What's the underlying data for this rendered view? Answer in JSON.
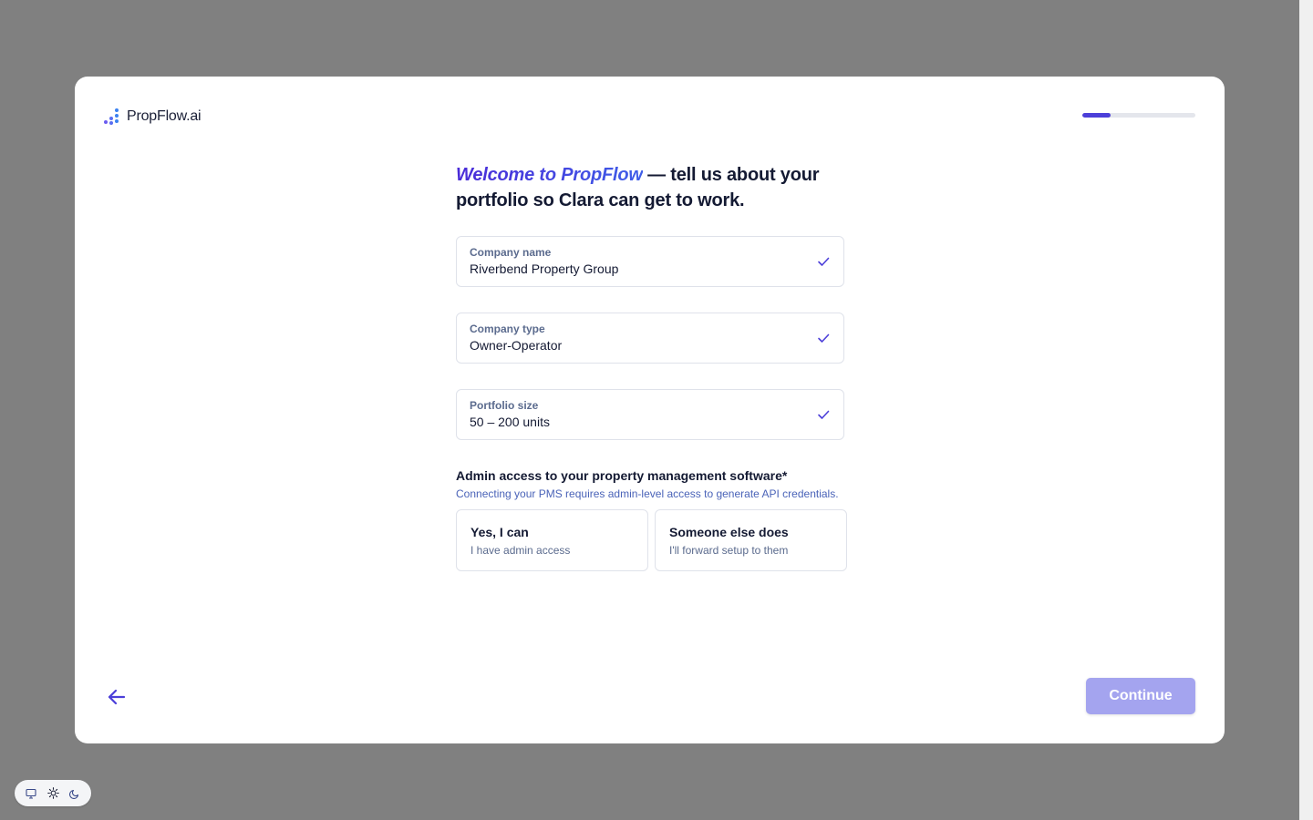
{
  "app": {
    "logo_text": "PropFlow.ai",
    "progress_fraction": 0.25
  },
  "headline": {
    "brand": "Welcome to PropFlow",
    "rest": " — tell us about your portfolio so Clara can get to work."
  },
  "fields": [
    {
      "label": "Company name",
      "value": "Riverbend Property Group"
    },
    {
      "label": "Company type",
      "value": "Owner-Operator"
    },
    {
      "label": "Portfolio size",
      "value": "50 – 200 units"
    }
  ],
  "admin": {
    "title": "Admin access to your property management software*",
    "description": "Connecting your PMS requires admin-level access to generate API credentials.",
    "options": [
      {
        "title": "Yes, I can",
        "subtitle": "I have admin access"
      },
      {
        "title": "Someone else does",
        "subtitle": "I'll forward setup to them"
      }
    ]
  },
  "footer": {
    "continue_label": "Continue"
  },
  "icons": {
    "back": "arrow-left-icon",
    "check": "check-icon",
    "monitor": "monitor-icon",
    "sun": "sun-icon",
    "moon": "moon-icon"
  },
  "colors": {
    "accent": "#4c3fd9",
    "continue_disabled": "#a4a4ef",
    "backdrop": "#808080"
  }
}
